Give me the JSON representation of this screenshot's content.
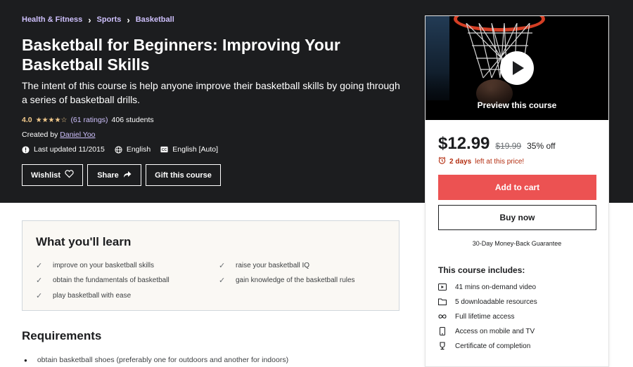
{
  "breadcrumb": [
    "Health & Fitness",
    "Sports",
    "Basketball"
  ],
  "course": {
    "title": "Basketball for Beginners: Improving Your Basketball Skills",
    "subtitle": "The intent of this course is help anyone improve their basketball skills by going through a series of basketball drills.",
    "rating": "4.0",
    "stars_value": 4.0,
    "ratings_count": "(61 ratings)",
    "students": "406 students",
    "created_by_label": "Created by",
    "instructor": "Daniel Yoo",
    "last_updated": "Last updated 11/2015",
    "language": "English",
    "captions": "English [Auto]"
  },
  "actions": {
    "wishlist": "Wishlist",
    "share": "Share",
    "gift": "Gift this course"
  },
  "learn": {
    "title": "What you'll learn",
    "items": [
      "improve on your basketball skills",
      "raise your basketball IQ",
      "obtain the fundamentals of basketball",
      "gain knowledge of the basketball rules",
      "play basketball with ease"
    ]
  },
  "requirements": {
    "title": "Requirements",
    "items": [
      "obtain basketball shoes (preferably one for outdoors and another for indoors)"
    ]
  },
  "sidebar": {
    "preview_label": "Preview this course",
    "price": "$12.99",
    "original_price": "$19.99",
    "discount": "35% off",
    "timer_bold": "2 days",
    "timer_rest": "left at this price!",
    "add_to_cart": "Add to cart",
    "buy_now": "Buy now",
    "guarantee": "30-Day Money-Back Guarantee",
    "includes_title": "This course includes:",
    "includes": [
      {
        "icon": "video-icon",
        "label": "41 mins on-demand video"
      },
      {
        "icon": "file-icon",
        "label": "5 downloadable resources"
      },
      {
        "icon": "infinity-icon",
        "label": "Full lifetime access"
      },
      {
        "icon": "mobile-icon",
        "label": "Access on mobile and TV"
      },
      {
        "icon": "trophy-icon",
        "label": "Certificate of completion"
      }
    ]
  },
  "colors": {
    "hero_bg": "#1c1d1f",
    "link_purple": "#cec0fc",
    "star": "#f3ca8c",
    "cart_button": "#ec5252",
    "timer_red": "#b32d0f"
  }
}
